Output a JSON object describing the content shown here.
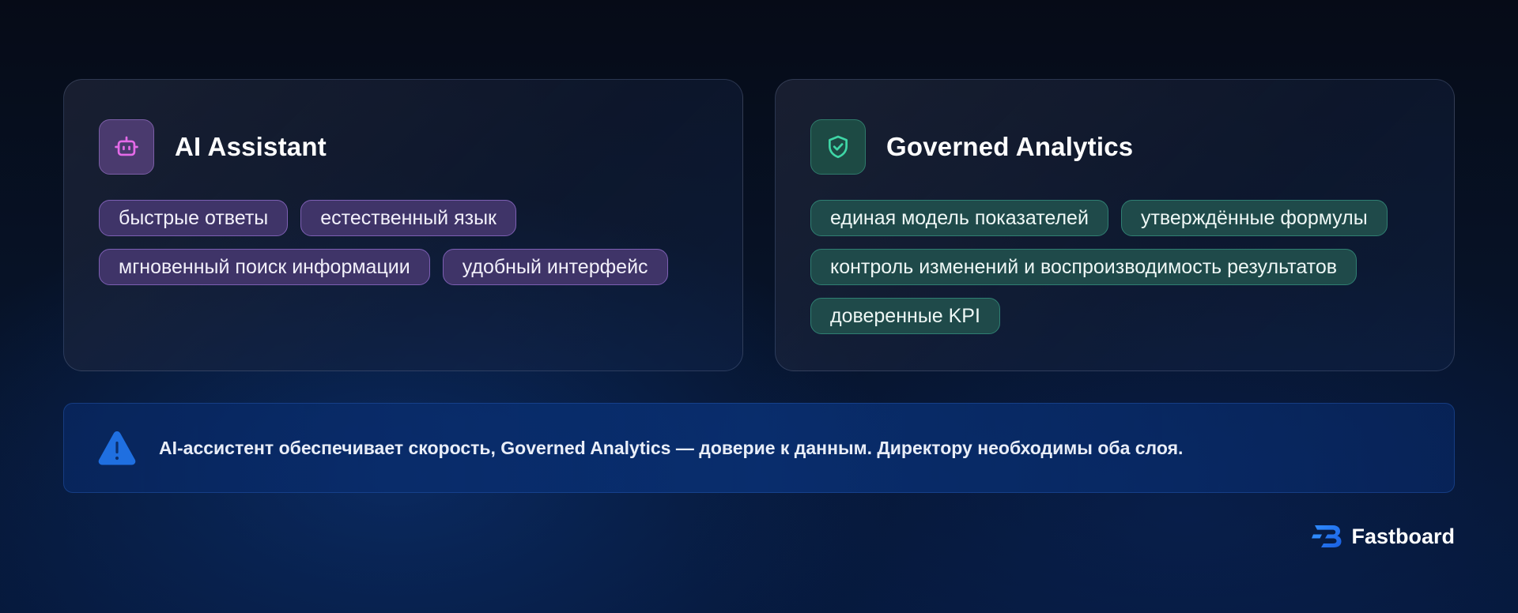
{
  "cards": [
    {
      "icon": "robot-icon",
      "title": "AI Assistant",
      "accent": "#d96be8",
      "tags": [
        "быстрые ответы",
        "естественный язык",
        "мгновенный поиск информации",
        "удобный интерфейс"
      ]
    },
    {
      "icon": "shield-check-icon",
      "title": "Governed Analytics",
      "accent": "#3fd6a6",
      "tags": [
        "единая модель показателей",
        "утверждённые формулы",
        "контроль изменений и воспроизводимость результатов",
        "доверенные KPI"
      ]
    }
  ],
  "note": {
    "icon": "warning-icon",
    "text": "AI-ассистент обеспечивает скорость, Governed Analytics — доверие к данным. Директору необходимы оба слоя."
  },
  "brand": {
    "icon": "fastboard-logo-icon",
    "name": "Fastboard"
  }
}
